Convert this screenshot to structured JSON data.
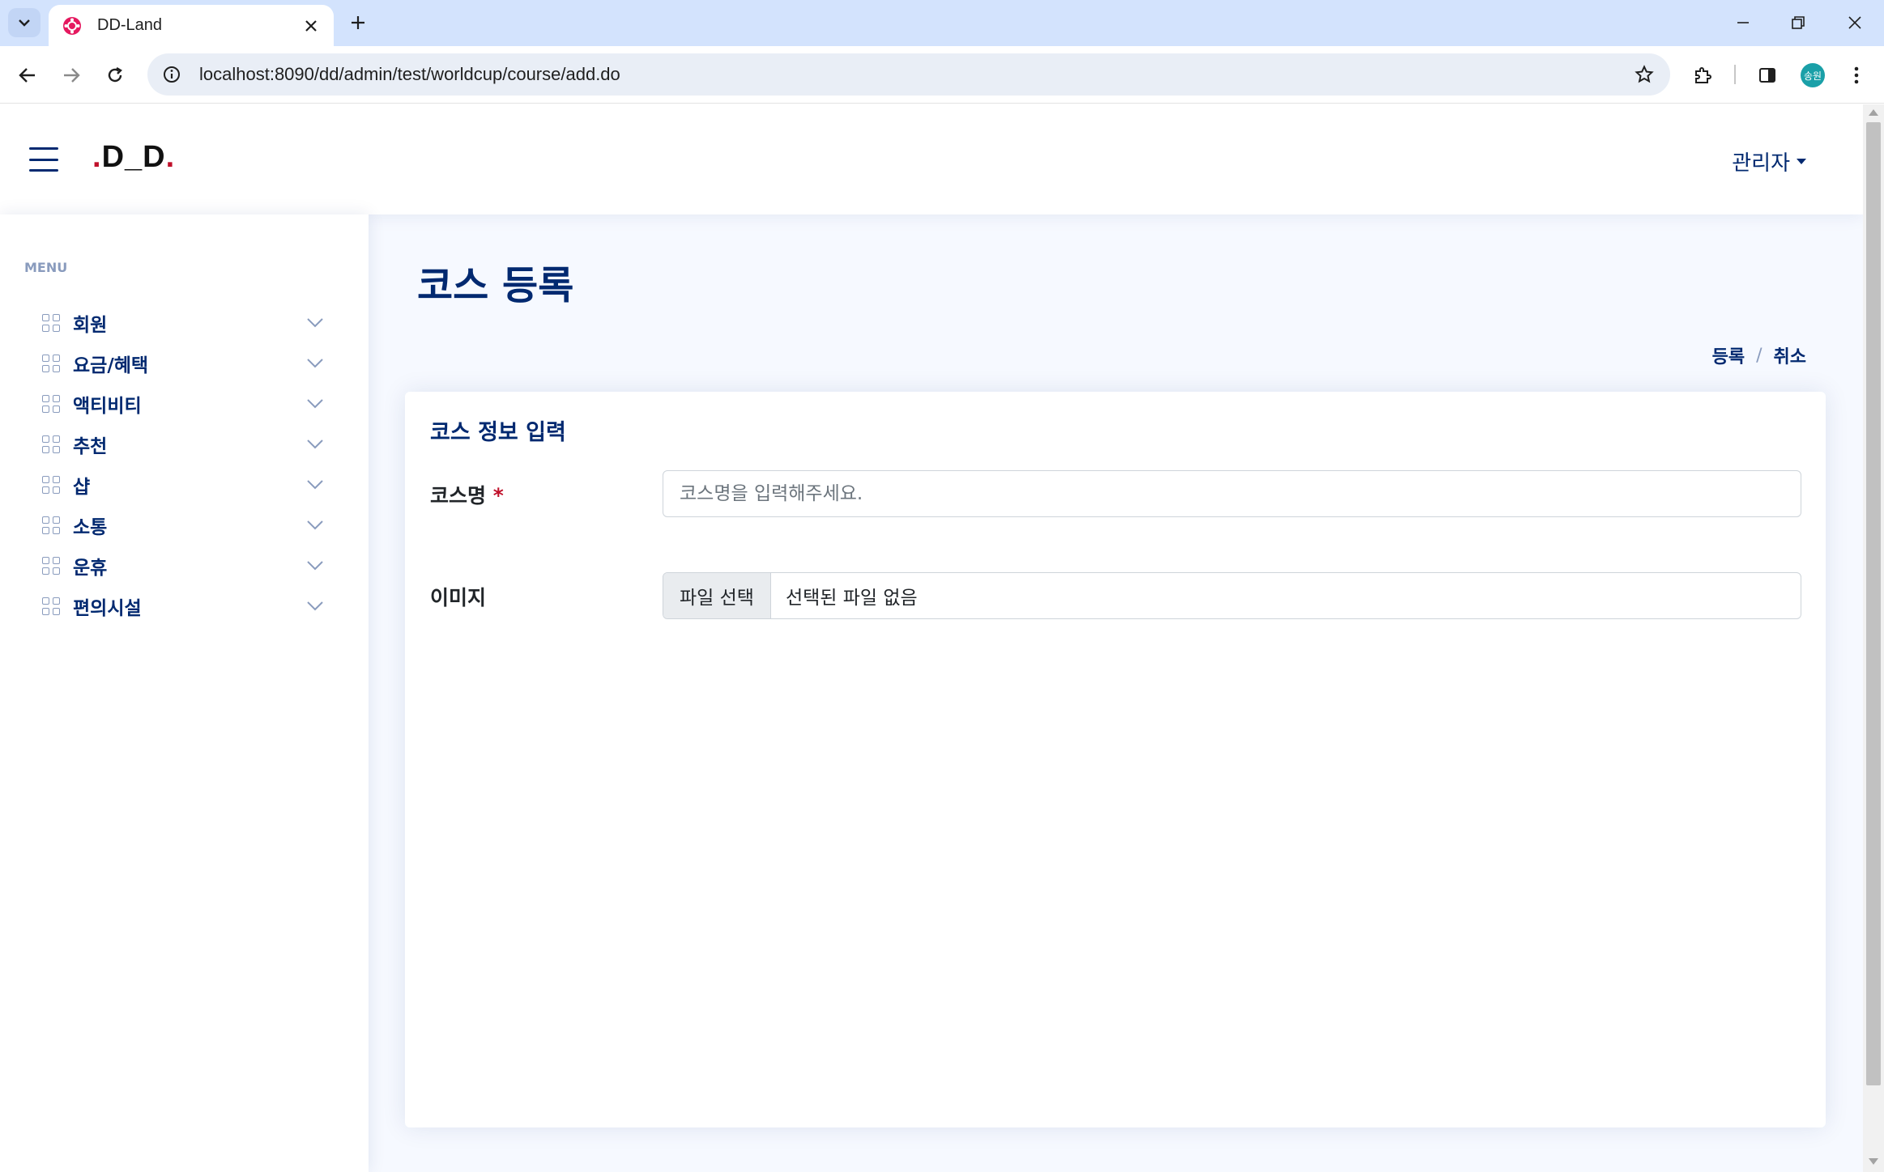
{
  "browser": {
    "tab_title": "DD-Land",
    "url": "localhost:8090/dd/admin/test/worldcup/course/add.do",
    "profile_initials": "송원"
  },
  "header": {
    "logo_dot1": ".",
    "logo_text": "D_D",
    "logo_dot2": ".",
    "admin_label": "관리자"
  },
  "sidebar": {
    "heading": "MENU",
    "items": [
      {
        "label": "회원",
        "icon": "grid-icon"
      },
      {
        "label": "요금/혜택",
        "icon": "grid-icon"
      },
      {
        "label": "액티비티",
        "icon": "grid-icon"
      },
      {
        "label": "추천",
        "icon": "grid-icon"
      },
      {
        "label": "샵",
        "icon": "grid-icon"
      },
      {
        "label": "소통",
        "icon": "grid-icon"
      },
      {
        "label": "운휴",
        "icon": "grid-icon"
      },
      {
        "label": "편의시설",
        "icon": "grid-icon"
      }
    ]
  },
  "main": {
    "page_title": "코스 등록",
    "breadcrumb": {
      "register": "등록",
      "separator": "/",
      "cancel": "취소"
    },
    "card": {
      "title": "코스 정보 입력",
      "course_name_label": "코스명",
      "required_mark": "*",
      "course_name_placeholder": "코스명을 입력해주세요.",
      "course_name_value": "",
      "image_label": "이미지",
      "file_button": "파일 선택",
      "file_status": "선택된 파일 없음"
    }
  },
  "colors": {
    "primary": "#012970",
    "accent": "#c0102a",
    "page_bg": "#f6f9ff",
    "tabbar_bg": "#d3e3fd"
  }
}
